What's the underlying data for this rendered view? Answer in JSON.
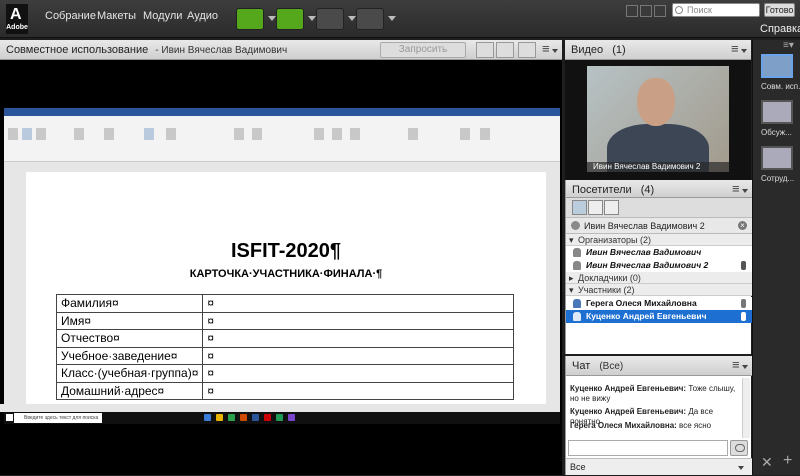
{
  "app": {
    "logo_text": "Adobe",
    "logo_glyph": "A"
  },
  "menu": [
    "Собрание",
    "Макеты",
    "Модули",
    "Аудио"
  ],
  "topright": {
    "search_placeholder": "Поиск",
    "ready_label": "Готово",
    "help_label": "Справка"
  },
  "share": {
    "title": "Совместное использование",
    "presenter": "- Ивин Вячеслав Вадимович",
    "request_control": "Запросить контроль"
  },
  "document": {
    "title": "ISFIT-2020¶",
    "subtitle": "КАРТОЧКА·УЧАСТНИКА·ФИНАЛА·¶",
    "rows": [
      {
        "label": "Фамилия¤",
        "value": "¤"
      },
      {
        "label": "Имя¤",
        "value": "¤"
      },
      {
        "label": "Отчество¤",
        "value": "¤"
      },
      {
        "label": "Учебное·заведение¤",
        "value": "¤"
      },
      {
        "label": "Класс·(учебная·группа)¤",
        "value": "¤"
      },
      {
        "label": "Домашний·адрес¤",
        "value": "¤"
      }
    ],
    "taskbar_search": "Введите здесь текст для поиска"
  },
  "video": {
    "title": "Видео",
    "count": "(1)",
    "name_overlay": "Ивин Вячеслав Вадимович 2"
  },
  "attendees": {
    "title": "Посетители",
    "count": "(4)",
    "host": "Ивин Вячеслав Вадимович 2",
    "sections": {
      "organizers": "Организаторы (2)",
      "presenters": "Докладчики (0)",
      "participants": "Участники (2)"
    },
    "organizers": [
      "Ивин Вячеслав Вадимович",
      "Ивин Вячеслав Вадимович 2"
    ],
    "participants": [
      "Герега Олеся Михайловна",
      "Куценко Андрей Евгеньевич"
    ]
  },
  "chat": {
    "title": "Чат",
    "scope": "(Все)",
    "messages": [
      {
        "author": "Куценко Андрей Евгеньевич:",
        "text": " Тоже слышу, но не вижу"
      },
      {
        "author": "Куценко Андрей Евгеньевич:",
        "text": " Да все понятно"
      },
      {
        "author": "Герега Олеся Михайловна:",
        "text": " все ясно"
      }
    ],
    "to": "Все"
  },
  "layouts": [
    "Совм. исп.",
    "Обсуж...",
    "Сотруд..."
  ],
  "colors": {
    "accent": "#1d6fd1",
    "green": "#55a81c",
    "word_blue": "#2b579a"
  }
}
